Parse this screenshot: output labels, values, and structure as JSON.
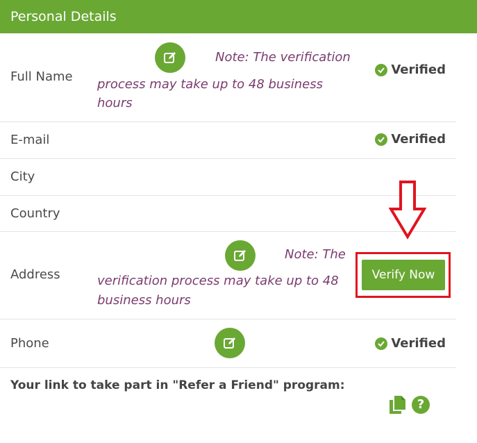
{
  "header": {
    "title": "Personal Details"
  },
  "rows": {
    "full_name": {
      "label": "Full Name",
      "note_line1": "Note: The verification",
      "note_line2": "process may take up to 48 business",
      "note_line3": "hours",
      "status": "Verified"
    },
    "email": {
      "label": "E-mail",
      "status": "Verified"
    },
    "city": {
      "label": "City"
    },
    "country": {
      "label": "Country"
    },
    "address": {
      "label": "Address",
      "note_line1": "Note: The",
      "note_line2": "verification process may take up to 48",
      "note_line3": "business hours",
      "verify_label": "Verify Now"
    },
    "phone": {
      "label": "Phone",
      "status": "Verified"
    }
  },
  "refer": {
    "text": "Your link to take part in \"Refer a Friend\" program:"
  },
  "icons": {
    "edit": "edit-icon",
    "check": "check-circle-icon",
    "copy": "copy-icon",
    "help": "question-circle-icon",
    "arrow": "arrow-down-icon"
  },
  "colors": {
    "accent": "#6aa834",
    "note": "#7a3b6e",
    "highlight": "#e0151f"
  }
}
